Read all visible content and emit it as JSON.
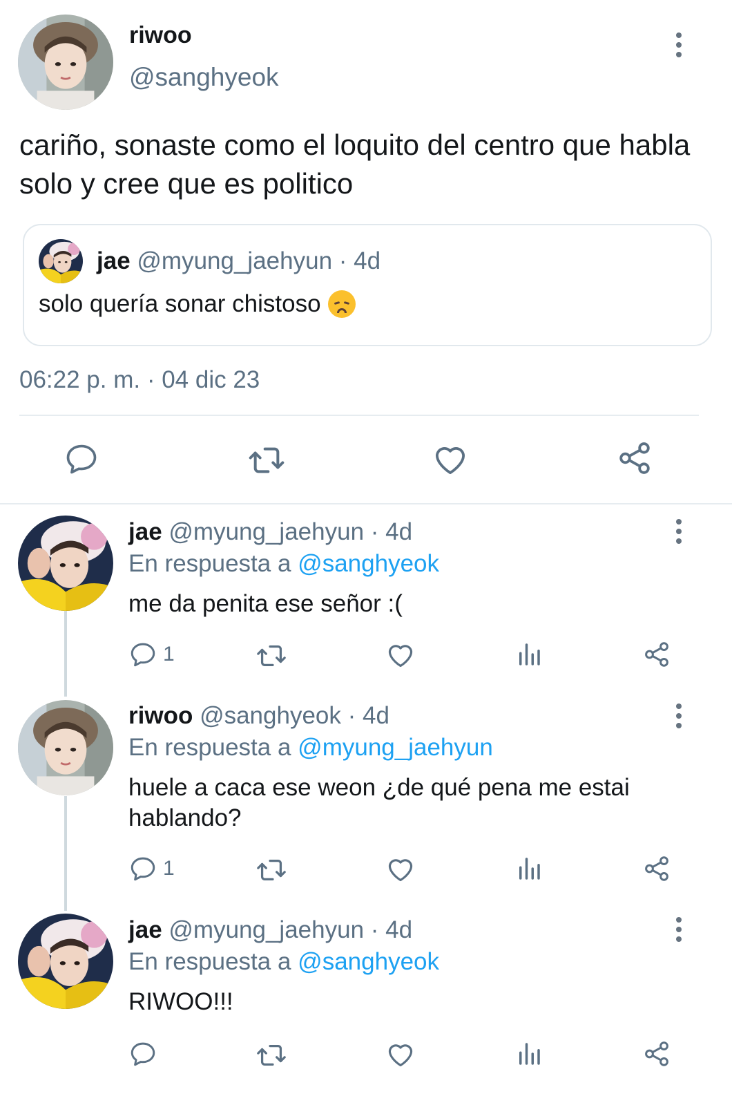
{
  "main_tweet": {
    "display_name": "riwoo",
    "handle": "@sanghyeok",
    "text": "cariño, sonaste como el loquito del centro que habla solo y cree que es politico",
    "timestamp": "06:22 p. m. · 04 dic 23",
    "quote": {
      "display_name": "jae",
      "handle_meta": "@myung_jaehyun · 4d",
      "text": "solo quería sonar chistoso"
    }
  },
  "replies": [
    {
      "display_name": "jae",
      "handle_meta": "@myung_jaehyun · 4d",
      "reply_prefix": "En respuesta a",
      "reply_to": "@sanghyeok",
      "text": "me da penita ese señor :(",
      "reply_count": "1"
    },
    {
      "display_name": "riwoo",
      "handle_meta": "@sanghyeok · 4d",
      "reply_prefix": "En respuesta a",
      "reply_to": "@myung_jaehyun",
      "text": "huele a caca ese weon ¿de qué pena me estai hablando?",
      "reply_count": "1"
    },
    {
      "display_name": "jae",
      "handle_meta": "@myung_jaehyun · 4d",
      "reply_prefix": "En respuesta a",
      "reply_to": "@sanghyeok",
      "text": "RIWOO!!!",
      "reply_count": ""
    }
  ],
  "icons": {
    "reply": "reply-icon",
    "retweet": "retweet-icon",
    "like": "heart-icon",
    "views": "analytics-icon",
    "share": "share-icon",
    "more": "more-icon",
    "emoji": "disappointed-face-emoji"
  },
  "colors": {
    "text": "#14171a",
    "secondary": "#5b7083",
    "link": "#1da1f2",
    "border": "#e1e8ed",
    "thread_line": "#cfd9de"
  }
}
